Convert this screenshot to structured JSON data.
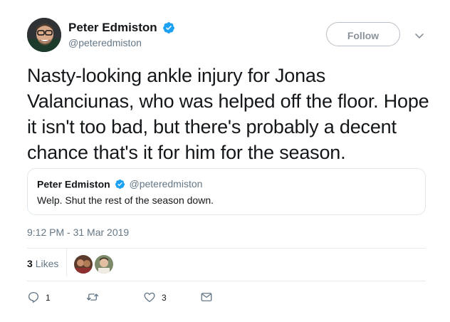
{
  "author": {
    "display_name": "Peter Edmiston",
    "handle": "@peteredmiston"
  },
  "follow_button": {
    "label": "Follow"
  },
  "tweet": {
    "text": "Nasty-looking ankle injury for Jonas Valanciunas, who was helped off the floor. Hope it isn't too bad, but there's probably a decent chance that's it for him for the season.",
    "timestamp": "9:12 PM - 31 Mar 2019"
  },
  "quoted_tweet": {
    "display_name": "Peter Edmiston",
    "handle": "@peteredmiston",
    "text": "Welp. Shut the rest of the season down."
  },
  "likes": {
    "count": "3",
    "label": "Likes"
  },
  "actions": {
    "reply_count": "1",
    "retweet_count": "",
    "like_count": "3"
  },
  "icons": {
    "verified": "verified-badge-icon",
    "caret": "chevron-down-icon",
    "reply": "reply-icon",
    "retweet": "retweet-icon",
    "like": "heart-icon",
    "dm": "envelope-icon"
  },
  "colors": {
    "verified_blue": "#1da1f2",
    "secondary_text": "#657786",
    "primary_text": "#14171a"
  }
}
